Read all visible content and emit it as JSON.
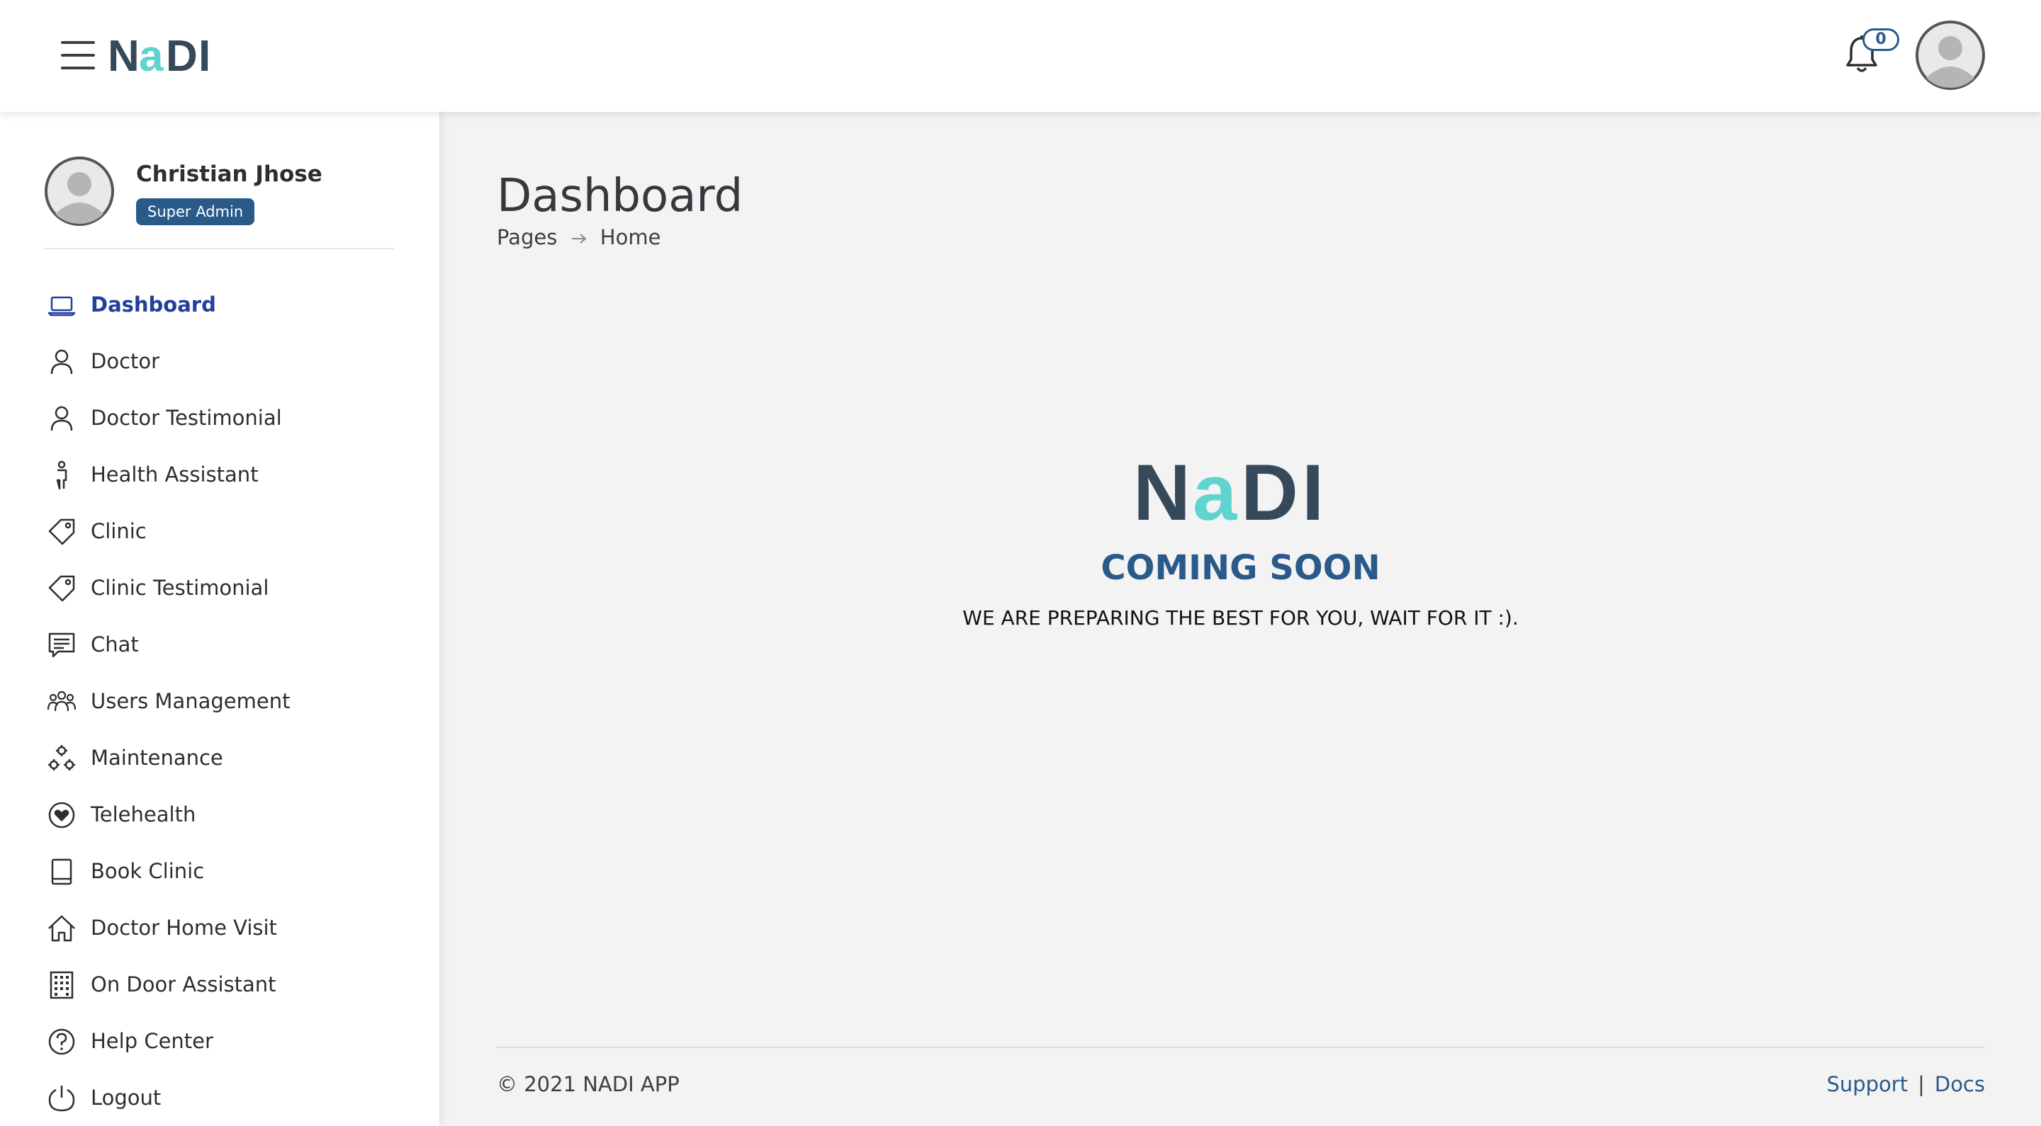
{
  "brand": {
    "name": "NADI",
    "letters": [
      "N",
      "a",
      "D",
      "I"
    ],
    "dark_color": "#36495a",
    "accent_color": "#5fd3cd"
  },
  "header": {
    "notification_count": "0"
  },
  "profile": {
    "name": "Christian Jhose",
    "role": "Super Admin"
  },
  "sidebar": {
    "items": [
      {
        "label": "Dashboard",
        "icon": "laptop-icon",
        "active": true
      },
      {
        "label": "Doctor",
        "icon": "person-icon"
      },
      {
        "label": "Doctor Testimonial",
        "icon": "person-icon"
      },
      {
        "label": "Health Assistant",
        "icon": "person-standing-icon"
      },
      {
        "label": "Clinic",
        "icon": "tag-icon"
      },
      {
        "label": "Clinic Testimonial",
        "icon": "tag-icon"
      },
      {
        "label": "Chat",
        "icon": "chat-icon"
      },
      {
        "label": "Users Management",
        "icon": "people-icon"
      },
      {
        "label": "Maintenance",
        "icon": "gears-icon"
      },
      {
        "label": "Telehealth",
        "icon": "heart-circle-icon"
      },
      {
        "label": "Book Clinic",
        "icon": "book-icon"
      },
      {
        "label": "Doctor Home Visit",
        "icon": "house-icon"
      },
      {
        "label": "On Door Assistant",
        "icon": "building-icon"
      },
      {
        "label": "Help Center",
        "icon": "question-circle-icon"
      },
      {
        "label": "Logout",
        "icon": "power-icon"
      }
    ]
  },
  "main": {
    "title": "Dashboard",
    "breadcrumb": [
      "Pages",
      "Home"
    ],
    "coming_soon": {
      "heading": "COMING SOON",
      "subtitle": "WE ARE PREPARING THE BEST FOR YOU, WAIT FOR IT :)."
    }
  },
  "footer": {
    "copyright": "© 2021 NADI APP",
    "links": [
      "Support",
      "Docs"
    ]
  },
  "colors": {
    "primary": "#2a5a8a",
    "active_nav": "#233e9b",
    "background": "#f3f3f3"
  }
}
